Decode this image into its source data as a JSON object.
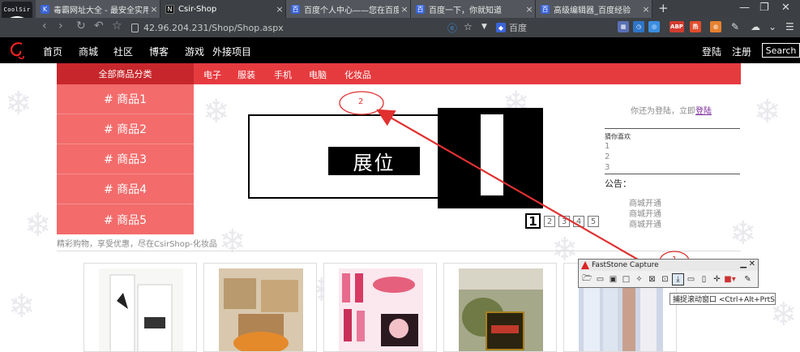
{
  "browser": {
    "logo_text": "CoolSir",
    "tabs": [
      {
        "label": "毒霸网址大全 - 最安全实用的",
        "fav": "K",
        "color": "#3a64d8",
        "active": false
      },
      {
        "label": "Csir-Shop",
        "fav": "N",
        "color": "#111111",
        "active": true
      },
      {
        "label": "百度个人中心——您在百度",
        "fav": "百",
        "color": "#3a64d8",
        "active": false
      },
      {
        "label": "百度一下，你就知道",
        "fav": "百",
        "color": "#3a64d8",
        "active": false
      },
      {
        "label": "高级编辑器_百度经验",
        "fav": "百",
        "color": "#3a64d8",
        "active": false
      }
    ],
    "url": "42.96.204.231/Shop/Shop.aspx",
    "search_placeholder": "百度",
    "extensions": [
      {
        "name": "grid",
        "text": "▦",
        "color": "#5a6fb5"
      },
      {
        "name": "clock",
        "text": "◷",
        "color": "#2e75c9"
      },
      {
        "name": "cart",
        "text": "◎",
        "color": "#3b8ee0"
      },
      {
        "name": "adblock",
        "text": "ABP",
        "color": "#d33b2f"
      },
      {
        "name": "ext-red",
        "text": "热",
        "color": "#e24c2b"
      },
      {
        "name": "ext-orange",
        "text": "◍",
        "color": "#e6812f"
      }
    ]
  },
  "site": {
    "nav": [
      "首页",
      "商城",
      "社区",
      "博客",
      "游戏",
      "外接项目"
    ],
    "login": "登陆",
    "register": "注册",
    "search_button": "Search"
  },
  "catbar": {
    "all": "全部商品分类",
    "items": [
      "电子",
      "服装",
      "手机",
      "电脑",
      "化妆品"
    ]
  },
  "sidebar": [
    "# 商品1",
    "# 商品2",
    "# 商品3",
    "# 商品4",
    "# 商品5"
  ],
  "banner": {
    "label": "展位",
    "pages": [
      "1",
      "2",
      "3",
      "4",
      "5"
    ]
  },
  "right": {
    "login_tip": "你还为登陆，立即",
    "login_link": "登陆",
    "guess_title": "猜你喜欢",
    "guess_items": [
      "1",
      "2",
      "3"
    ],
    "notice_title": "公告：",
    "notices": [
      "商城开通",
      "商城开通",
      "商城开通"
    ]
  },
  "slogan": "精彩购物，享受优惠，尽在CsirShop-化妆品",
  "annotations": {
    "one": "1",
    "two": "2",
    "color": "#e03030"
  },
  "faststone": {
    "title": "FastStone Capture",
    "tooltip": "捕捉滚动窗口 <Ctrl+Alt+PrtSc>"
  }
}
